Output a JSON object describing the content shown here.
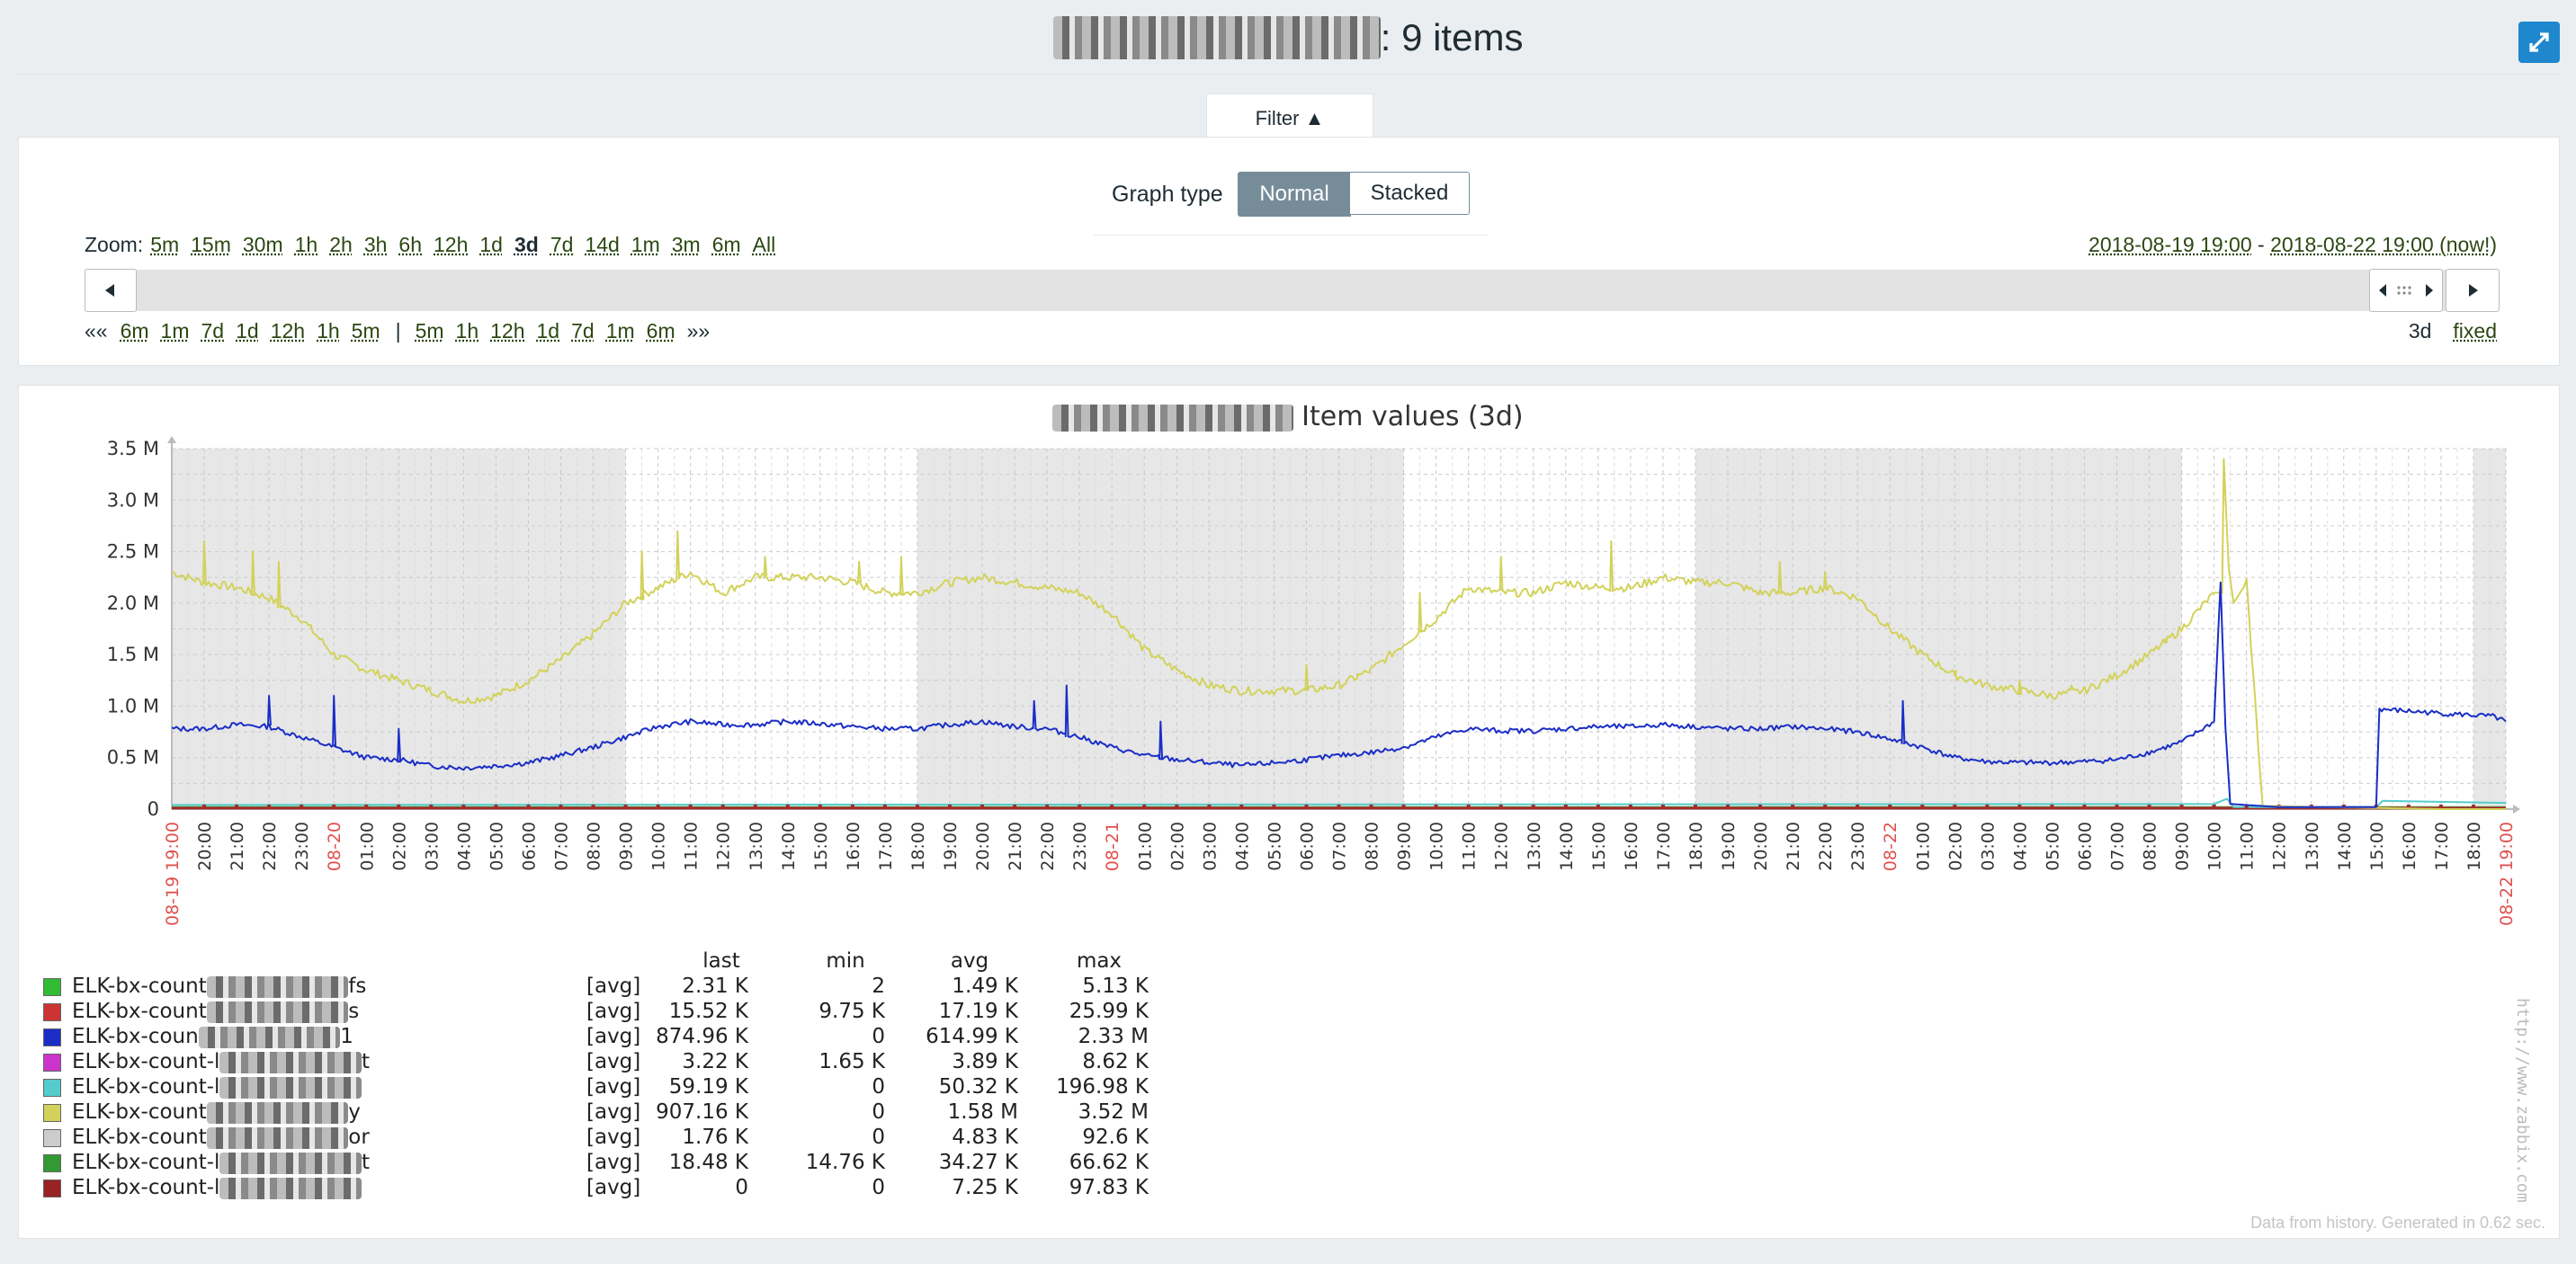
{
  "page": {
    "title_suffix": ": 9 items",
    "filter_tab": "Filter ▲",
    "graph_type_label": "Graph type",
    "graph_type_options": [
      "Normal",
      "Stacked"
    ],
    "graph_type_selected": "Normal",
    "zoom_label": "Zoom:",
    "zoom_options": [
      "5m",
      "15m",
      "30m",
      "1h",
      "2h",
      "3h",
      "6h",
      "12h",
      "1d",
      "3d",
      "7d",
      "14d",
      "1m",
      "3m",
      "6m",
      "All"
    ],
    "zoom_selected": "3d",
    "period_from": "2018-08-19 19:00",
    "period_sep": " - ",
    "period_to": "2018-08-22 19:00 (now!)",
    "nav_back_prefix": "««",
    "nav_back": [
      "6m",
      "1m",
      "7d",
      "1d",
      "12h",
      "1h",
      "5m"
    ],
    "nav_sep": "|",
    "nav_forward": [
      "5m",
      "1h",
      "12h",
      "1d",
      "7d",
      "1m",
      "6m"
    ],
    "nav_forward_suffix": "»»",
    "period_length": "3d",
    "period_mode": "fixed",
    "footer": "Data from history. Generated in 0.62 sec.",
    "vertical_url": "http://www.zabbix.com",
    "icons": [
      "fullscreen-icon",
      "arrow-left-icon",
      "arrow-right-icon",
      "resize-handle-icon"
    ],
    "accent_color": "#1e87cd"
  },
  "chart_data": {
    "type": "line",
    "title": "Item values (3d)",
    "y_ticks": [
      "0",
      "0.5 M",
      "1.0 M",
      "1.5 M",
      "2.0 M",
      "2.5 M",
      "3.0 M",
      "3.5 M"
    ],
    "ylim": [
      0,
      3500000
    ],
    "x_ticks": [
      "08-19 19:00",
      "20:00",
      "21:00",
      "22:00",
      "23:00",
      "08-20",
      "01:00",
      "02:00",
      "03:00",
      "04:00",
      "05:00",
      "06:00",
      "07:00",
      "08:00",
      "09:00",
      "10:00",
      "11:00",
      "12:00",
      "13:00",
      "14:00",
      "15:00",
      "16:00",
      "17:00",
      "18:00",
      "19:00",
      "20:00",
      "21:00",
      "22:00",
      "23:00",
      "08-21",
      "01:00",
      "02:00",
      "03:00",
      "04:00",
      "05:00",
      "06:00",
      "07:00",
      "08:00",
      "09:00",
      "10:00",
      "11:00",
      "12:00",
      "13:00",
      "14:00",
      "15:00",
      "16:00",
      "17:00",
      "18:00",
      "19:00",
      "20:00",
      "21:00",
      "22:00",
      "23:00",
      "08-22",
      "01:00",
      "02:00",
      "03:00",
      "04:00",
      "05:00",
      "06:00",
      "07:00",
      "08:00",
      "09:00",
      "10:00",
      "11:00",
      "12:00",
      "13:00",
      "14:00",
      "15:00",
      "16:00",
      "17:00",
      "18:00",
      "08-22 19:00"
    ],
    "x_unit": "hours since 08-19 19:00",
    "xlim": [
      0,
      72
    ],
    "grid": true,
    "night_bands_hours": [
      [
        0,
        14
      ],
      [
        23,
        38
      ],
      [
        47,
        62
      ],
      [
        71,
        72
      ]
    ],
    "series": [
      {
        "name": "ELK-bx-count",
        "color": "#d2d25a",
        "points": [
          [
            0,
            2.3
          ],
          [
            1,
            2.2
          ],
          [
            2,
            2.15
          ],
          [
            3,
            2.05
          ],
          [
            4,
            1.85
          ],
          [
            5,
            1.5
          ],
          [
            6,
            1.35
          ],
          [
            7,
            1.25
          ],
          [
            8,
            1.15
          ],
          [
            9,
            1.05
          ],
          [
            10,
            1.1
          ],
          [
            11,
            1.25
          ],
          [
            12,
            1.45
          ],
          [
            13,
            1.7
          ],
          [
            14,
            2.0
          ],
          [
            15,
            2.15
          ],
          [
            16,
            2.3
          ],
          [
            17,
            2.1
          ],
          [
            18,
            2.25
          ],
          [
            19,
            2.25
          ],
          [
            20,
            2.25
          ],
          [
            21,
            2.2
          ],
          [
            22,
            2.1
          ],
          [
            23,
            2.1
          ],
          [
            24,
            2.2
          ],
          [
            25,
            2.25
          ],
          [
            26,
            2.2
          ],
          [
            27,
            2.15
          ],
          [
            28,
            2.1
          ],
          [
            29,
            1.9
          ],
          [
            30,
            1.55
          ],
          [
            31,
            1.35
          ],
          [
            32,
            1.2
          ],
          [
            33,
            1.15
          ],
          [
            34,
            1.15
          ],
          [
            35,
            1.15
          ],
          [
            36,
            1.2
          ],
          [
            37,
            1.35
          ],
          [
            38,
            1.6
          ],
          [
            39,
            1.85
          ],
          [
            40,
            2.15
          ],
          [
            41,
            2.1
          ],
          [
            42,
            2.1
          ],
          [
            43,
            2.2
          ],
          [
            44,
            2.15
          ],
          [
            45,
            2.15
          ],
          [
            46,
            2.25
          ],
          [
            47,
            2.2
          ],
          [
            48,
            2.2
          ],
          [
            49,
            2.1
          ],
          [
            50,
            2.1
          ],
          [
            51,
            2.15
          ],
          [
            52,
            2.05
          ],
          [
            53,
            1.75
          ],
          [
            54,
            1.5
          ],
          [
            55,
            1.3
          ],
          [
            56,
            1.2
          ],
          [
            57,
            1.15
          ],
          [
            58,
            1.1
          ],
          [
            59,
            1.15
          ],
          [
            60,
            1.3
          ],
          [
            61,
            1.5
          ],
          [
            62,
            1.75
          ],
          [
            63,
            2.1
          ],
          [
            63.25,
            2.1
          ],
          [
            63.3,
            3.4
          ],
          [
            63.45,
            2.35
          ],
          [
            63.6,
            2.0
          ],
          [
            64.0,
            2.2
          ],
          [
            64.5,
            0.03
          ],
          [
            70.0,
            0.0
          ],
          [
            72,
            0.0
          ]
        ],
        "spikes": [
          [
            1,
            2.6
          ],
          [
            2.5,
            2.5
          ],
          [
            3.3,
            2.4
          ],
          [
            14.5,
            2.5
          ],
          [
            15.6,
            2.7
          ],
          [
            18.3,
            2.45
          ],
          [
            21.2,
            2.4
          ],
          [
            22.5,
            2.45
          ],
          [
            35,
            1.4
          ],
          [
            36.6,
            1.3
          ],
          [
            38.5,
            2.1
          ],
          [
            41,
            2.45
          ],
          [
            44.4,
            2.6
          ],
          [
            49.6,
            2.4
          ],
          [
            51,
            2.3
          ],
          [
            55,
            1.3
          ],
          [
            57,
            1.25
          ],
          [
            58.6,
            1.2
          ],
          [
            61.5,
            1.65
          ]
        ]
      },
      {
        "name": "ELK-bx-coun",
        "color": "#1a2ec6",
        "points": [
          [
            0,
            0.78
          ],
          [
            1,
            0.78
          ],
          [
            2,
            0.82
          ],
          [
            3,
            0.8
          ],
          [
            4,
            0.7
          ],
          [
            5,
            0.6
          ],
          [
            6,
            0.5
          ],
          [
            7,
            0.48
          ],
          [
            8,
            0.42
          ],
          [
            9,
            0.4
          ],
          [
            10,
            0.42
          ],
          [
            11,
            0.45
          ],
          [
            12,
            0.52
          ],
          [
            13,
            0.6
          ],
          [
            14,
            0.7
          ],
          [
            15,
            0.8
          ],
          [
            16,
            0.85
          ],
          [
            17,
            0.82
          ],
          [
            18,
            0.82
          ],
          [
            19,
            0.85
          ],
          [
            20,
            0.83
          ],
          [
            21,
            0.8
          ],
          [
            22,
            0.78
          ],
          [
            23,
            0.78
          ],
          [
            24,
            0.82
          ],
          [
            25,
            0.85
          ],
          [
            26,
            0.8
          ],
          [
            27,
            0.78
          ],
          [
            28,
            0.7
          ],
          [
            29,
            0.6
          ],
          [
            30,
            0.52
          ],
          [
            31,
            0.48
          ],
          [
            32,
            0.45
          ],
          [
            33,
            0.42
          ],
          [
            34,
            0.45
          ],
          [
            35,
            0.48
          ],
          [
            36,
            0.52
          ],
          [
            37,
            0.55
          ],
          [
            38,
            0.6
          ],
          [
            39,
            0.7
          ],
          [
            40,
            0.78
          ],
          [
            41,
            0.76
          ],
          [
            42,
            0.76
          ],
          [
            43,
            0.78
          ],
          [
            44,
            0.8
          ],
          [
            45,
            0.8
          ],
          [
            46,
            0.82
          ],
          [
            47,
            0.8
          ],
          [
            48,
            0.78
          ],
          [
            49,
            0.78
          ],
          [
            50,
            0.8
          ],
          [
            51,
            0.78
          ],
          [
            52,
            0.75
          ],
          [
            53,
            0.68
          ],
          [
            54,
            0.6
          ],
          [
            55,
            0.5
          ],
          [
            56,
            0.46
          ],
          [
            57,
            0.45
          ],
          [
            58,
            0.45
          ],
          [
            59,
            0.46
          ],
          [
            60,
            0.48
          ],
          [
            61,
            0.55
          ],
          [
            62,
            0.65
          ],
          [
            63,
            0.85
          ],
          [
            63.2,
            2.2
          ],
          [
            63.35,
            0.8
          ],
          [
            63.5,
            0.05
          ],
          [
            65,
            0.02
          ],
          [
            68.0,
            0.02
          ],
          [
            68.1,
            0.97
          ],
          [
            70,
            0.93
          ],
          [
            71.6,
            0.9
          ],
          [
            72,
            0.85
          ]
        ],
        "spikes": [
          [
            3,
            1.1
          ],
          [
            5,
            1.1
          ],
          [
            7,
            0.78
          ],
          [
            26.6,
            1.05
          ],
          [
            27.6,
            1.2
          ],
          [
            30.5,
            0.85
          ],
          [
            53.4,
            1.05
          ]
        ]
      },
      {
        "name": "ELK-bx-count-l",
        "color": "#3cb84a",
        "points": [
          [
            0,
            0.02
          ],
          [
            72,
            0.02
          ]
        ]
      },
      {
        "name": "ELK-bx-count-l",
        "color": "#a52a2a",
        "points": [
          [
            0,
            0.01
          ],
          [
            72,
            0.01
          ]
        ]
      },
      {
        "name": "ELK-bx-count-l",
        "color": "#55cccc",
        "points": [
          [
            0,
            0.04
          ],
          [
            63,
            0.05
          ],
          [
            63.4,
            0.1
          ],
          [
            63.6,
            0.02
          ],
          [
            68.0,
            0.02
          ],
          [
            68.2,
            0.08
          ],
          [
            72,
            0.06
          ]
        ]
      }
    ],
    "legend": {
      "headers": [
        "last",
        "min",
        "avg",
        "max"
      ],
      "rows": [
        {
          "name": "ELK-bx-count",
          "suffix": "fs",
          "color": "#33bb33",
          "func": "[avg]",
          "last": "2.31 K",
          "min": "2",
          "avg": "1.49 K",
          "max": "5.13 K"
        },
        {
          "name": "ELK-bx-count",
          "suffix": "s",
          "color": "#cc3333",
          "func": "[avg]",
          "last": "15.52 K",
          "min": "9.75 K",
          "avg": "17.19 K",
          "max": "25.99 K"
        },
        {
          "name": "ELK-bx-coun",
          "suffix": "1",
          "color": "#1a2ec6",
          "func": "[avg]",
          "last": "874.96 K",
          "min": "0",
          "avg": "614.99 K",
          "max": "2.33 M"
        },
        {
          "name": "ELK-bx-count-l",
          "suffix": "t",
          "color": "#cc33cc",
          "func": "[avg]",
          "last": "3.22 K",
          "min": "1.65 K",
          "avg": "3.89 K",
          "max": "8.62 K"
        },
        {
          "name": "ELK-bx-count-l",
          "suffix": "",
          "color": "#55cccc",
          "func": "[avg]",
          "last": "59.19 K",
          "min": "0",
          "avg": "50.32 K",
          "max": "196.98 K"
        },
        {
          "name": "ELK-bx-count",
          "suffix": "y",
          "color": "#d2d25a",
          "func": "[avg]",
          "last": "907.16 K",
          "min": "0",
          "avg": "1.58 M",
          "max": "3.52 M"
        },
        {
          "name": "ELK-bx-count",
          "suffix": "or",
          "color": "#cccccc",
          "func": "[avg]",
          "last": "1.76 K",
          "min": "0",
          "avg": "4.83 K",
          "max": "92.6 K"
        },
        {
          "name": "ELK-bx-count-l",
          "suffix": "t",
          "color": "#339933",
          "func": "[avg]",
          "last": "18.48 K",
          "min": "14.76 K",
          "avg": "34.27 K",
          "max": "66.62 K"
        },
        {
          "name": "ELK-bx-count-l",
          "suffix": "",
          "color": "#992222",
          "func": "[avg]",
          "last": "0",
          "min": "0",
          "avg": "7.25 K",
          "max": "97.83 K"
        }
      ]
    }
  }
}
